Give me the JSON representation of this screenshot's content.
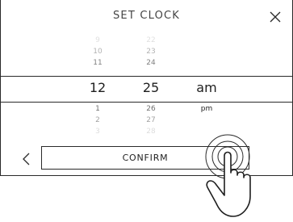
{
  "dialog": {
    "title": "SET CLOCK",
    "close_icon": "close-icon"
  },
  "picker": {
    "hour": {
      "above": [
        "9",
        "10",
        "11"
      ],
      "selected": "12",
      "below": [
        "1",
        "2",
        "3"
      ]
    },
    "minute": {
      "above": [
        "22",
        "23",
        "24"
      ],
      "selected": "25",
      "below": [
        "26",
        "27",
        "28"
      ]
    },
    "period": {
      "selected": "am",
      "below": [
        "pm"
      ]
    }
  },
  "footer": {
    "back_icon": "chevron-left-icon",
    "confirm_label": "CONFIRM"
  },
  "overlay": {
    "gesture_icon": "tap-hand-icon"
  },
  "colors": {
    "border": "#2a2a2a",
    "text": "#1e1e1e"
  }
}
